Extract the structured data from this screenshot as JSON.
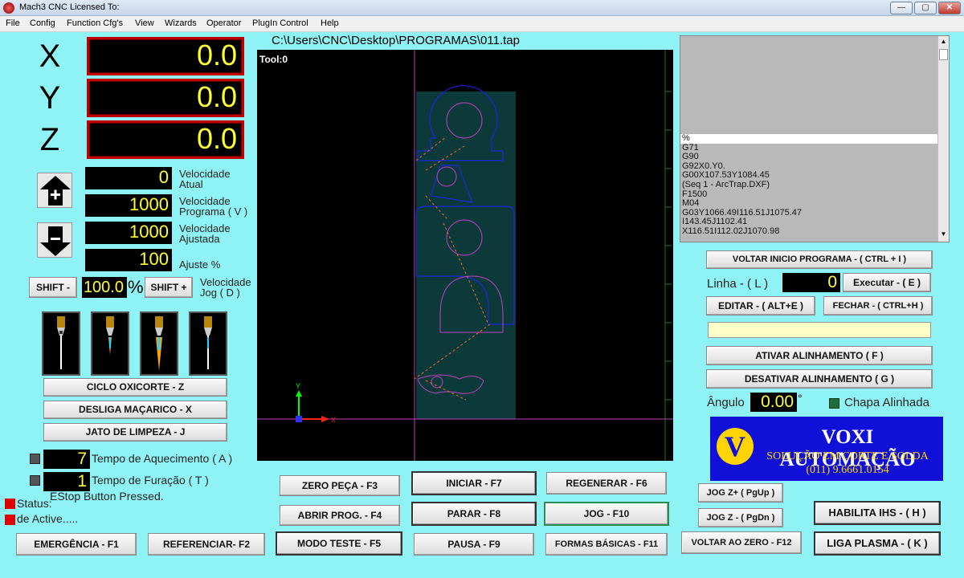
{
  "window": {
    "title": "Mach3 CNC  Licensed To:",
    "buttons": {
      "minimize": "—",
      "maximize": "▢",
      "close": "✕"
    }
  },
  "menu": [
    "File",
    "Config",
    "Function Cfg's",
    "View",
    "Wizards",
    "Operator",
    "PlugIn Control",
    "Help"
  ],
  "dro": {
    "x": {
      "label": "X",
      "value": "0.0"
    },
    "y": {
      "label": "Y",
      "value": "0.0"
    },
    "z": {
      "label": "Z",
      "value": "0.0"
    }
  },
  "feed": {
    "atual": {
      "value": "0",
      "label1": "Velocidade",
      "label2": "Atual"
    },
    "programa": {
      "value": "1000",
      "label1": "Velocidade",
      "label2": "Programa ( V )"
    },
    "ajustada": {
      "value": "1000",
      "label1": "Velocidade",
      "label2": "Ajustada"
    },
    "ajuste": {
      "value": "100",
      "label": "Ajuste  %"
    }
  },
  "jog": {
    "shift_minus": "SHIFT -",
    "percent_value": "100.0",
    "percent_sign": "%",
    "shift_plus": "SHIFT +",
    "label1": "Velocidade",
    "label2": "Jog ( D )"
  },
  "torch_buttons": {
    "ciclo": "CICLO OXICORTE - Z",
    "desliga": "DESLIGA MAÇARICO - X",
    "jato": "JATO DE LIMPEZA - J"
  },
  "timers": {
    "aquecimento": {
      "value": "7",
      "label": "Tempo de Aquecimento ( A )"
    },
    "furacao": {
      "value": "1",
      "label": "Tempo de Furação ( T )"
    }
  },
  "status": {
    "message": "EStop Button Pressed.",
    "status_label": "Status:",
    "mode_label": "de Active....."
  },
  "file_path": "C:\\Users\\CNC\\Desktop\\PROGRAMAS\\011.tap",
  "toolpath": {
    "tool_label": "Tool:0",
    "axis_y": "Y",
    "axis_x": "X"
  },
  "gcode": [
    "%",
    "G71",
    "G90",
    "G92X0.Y0.",
    "G00X107.53Y1084.45",
    "(Seq 1 - ArcTrap.DXF)",
    "F1500",
    "M04",
    "G03Y1066.49I116.51J1075.47",
    "I143.45J1102.41",
    "X116.51I112.02J1070.98"
  ],
  "right_panel": {
    "voltar_inicio": "VOLTAR INICIO PROGRAMA - ( CTRL + I )",
    "linha_label": "Linha - ( L )",
    "linha_value": "0",
    "executar": "Executar - ( E )",
    "editar": "EDITAR - ( ALT+E )",
    "fechar": "FECHAR - ( CTRL+H )",
    "ativar": "ATIVAR ALINHAMENTO ( F )",
    "desativar": "DESATIVAR ALINHAMENTO ( G )",
    "angulo_label": "Ângulo",
    "angulo_value": "0.00",
    "degree": "°",
    "chapa": "Chapa Alinhada"
  },
  "logo": {
    "letter": "V",
    "name": "VOXI AUTOMAÇÃO",
    "tagline": "SOLUÇÃO EM CORTE E SOLDA",
    "phone": "(011) 9.6661.0154"
  },
  "bottom_buttons": {
    "zero_peca": "ZERO PEÇA - F3",
    "iniciar": "INICIAR - F7",
    "regenerar": "REGENERAR - F6",
    "abrir": "ABRIR PROG. -  F4",
    "parar": "PARAR - F8",
    "jog": "JOG - F10",
    "emergencia": "EMERGÊNCIA - F1",
    "referenciar": "REFERENCIAR- F2",
    "modo_teste": "MODO TESTE  - F5",
    "pausa": "PAUSA - F9",
    "formas": "FORMAS BÁSICAS - F11",
    "jog_zplus": "JOG Z+ ( PgUp )",
    "jog_zminus": "JOG Z -  ( PgDn )",
    "voltar_zero": "VOLTAR AO ZERO - F12",
    "habilita_ihs": "HABILITA  IHS - ( H )",
    "liga_plasma": "LIGA PLASMA - ( K )"
  },
  "colors": {
    "background": "#8ff3f6",
    "dro_text": "#ffff33",
    "dro_border": "#c00000",
    "toolpath_magenta": "#c040c0",
    "toolpath_blue": "#2020ff",
    "logo_blue": "#1010d8"
  }
}
